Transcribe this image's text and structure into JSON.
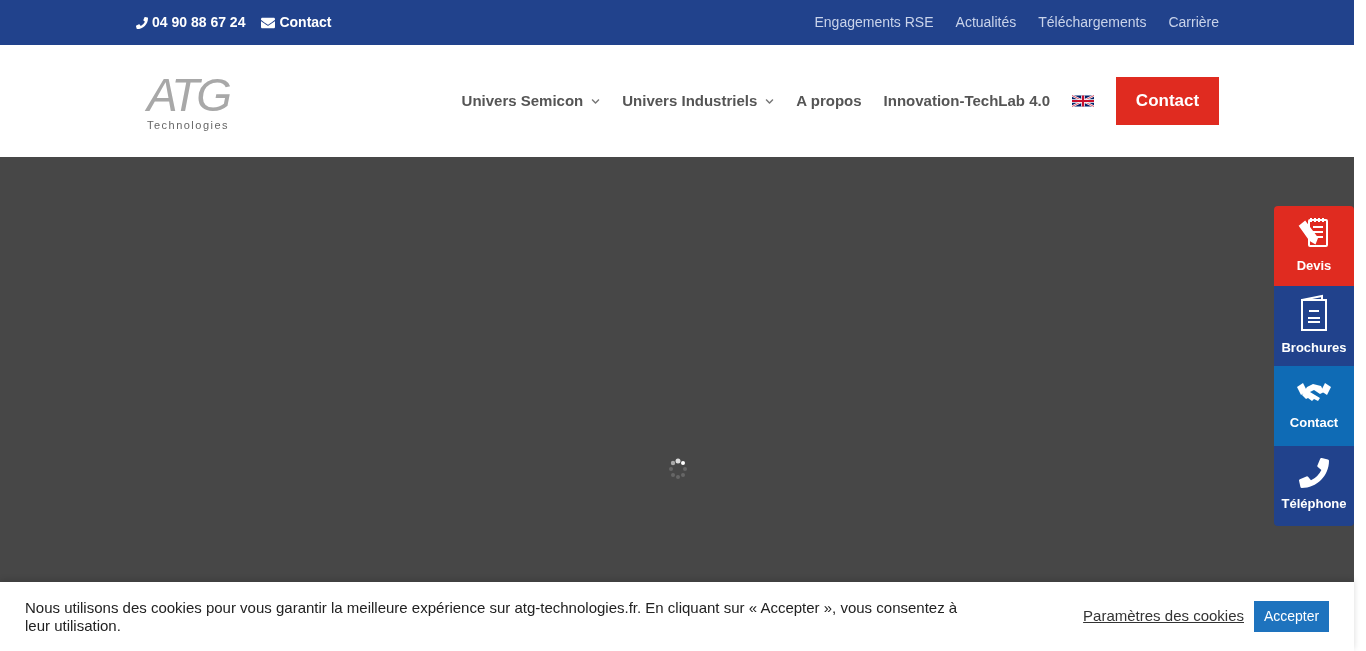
{
  "top_bar": {
    "phone": "04 90 88 67 24",
    "contact": "Contact",
    "links": [
      "Engagements RSE",
      "Actualités",
      "Téléchargements",
      "Carrière"
    ]
  },
  "header": {
    "logo": {
      "text": "ATG",
      "subtext": "Technologies"
    },
    "nav": [
      {
        "label": "Univers Semicon",
        "has_submenu": true
      },
      {
        "label": "Univers Industriels",
        "has_submenu": true
      },
      {
        "label": "A propos",
        "has_submenu": false
      },
      {
        "label": "Innovation-TechLab 4.0",
        "has_submenu": false
      }
    ],
    "contact_button": "Contact"
  },
  "side_buttons": [
    {
      "kind": "quote",
      "label": "Devis",
      "color": "#e02b20"
    },
    {
      "kind": "brochure",
      "label": "Brochures",
      "color": "#21428c"
    },
    {
      "kind": "handshake",
      "label": "Contact",
      "color": "#0f6bb5"
    },
    {
      "kind": "phone",
      "label": "Téléphone",
      "color": "#21428c"
    }
  ],
  "cookie_bar": {
    "message": "Nous utilisons des cookies pour vous garantir la meilleure expérience sur atg-technologies.fr. En cliquant sur « Accepter », vous consentez à leur utilisation.",
    "settings_link": "Paramètres des cookies",
    "accept_button": "Accepter"
  }
}
